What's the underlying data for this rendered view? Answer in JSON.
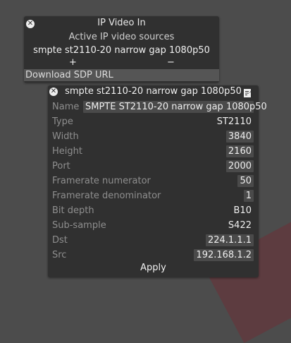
{
  "ip_panel": {
    "title": "IP Video In",
    "subtitle": "Active IP video sources",
    "source": "smpte st2110-20 narrow gap 1080p50",
    "add_label": "+",
    "remove_label": "−",
    "download_label": "Download SDP URL",
    "close_symbol": "✕"
  },
  "sdp_panel": {
    "title": "smpte st2110-20 narrow gap 1080p50",
    "close_symbol": "✕",
    "apply_label": "Apply",
    "rows": [
      {
        "label": "Name",
        "value": "SMPTE ST2110-20 narrow gap 1080p50"
      },
      {
        "label": "Type",
        "value": "ST2110"
      },
      {
        "label": "Width",
        "value": "3840"
      },
      {
        "label": "Height",
        "value": "2160"
      },
      {
        "label": "Port",
        "value": "2000"
      },
      {
        "label": "Framerate numerator",
        "value": "50"
      },
      {
        "label": "Framerate denominator",
        "value": "1"
      },
      {
        "label": "Bit depth",
        "value": "B10"
      },
      {
        "label": "Sub-sample",
        "value": "S422"
      },
      {
        "label": "Dst",
        "value": "224.1.1.1"
      },
      {
        "label": "Src",
        "value": "192.168.1.2"
      }
    ]
  },
  "icons": {
    "close": "close-icon",
    "edit": "edit-note-icon"
  }
}
